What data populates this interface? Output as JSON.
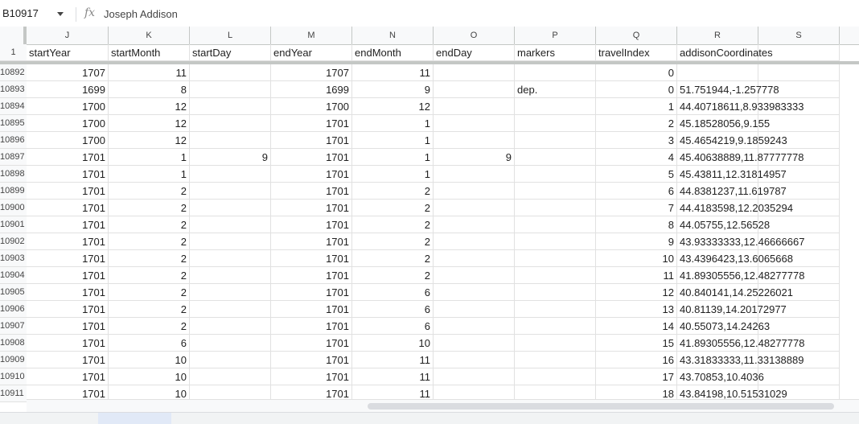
{
  "formula_bar": {
    "name_box": "B10917",
    "fx_icon": "fx",
    "content": "Joseph Addison"
  },
  "columns": [
    "J",
    "K",
    "L",
    "M",
    "N",
    "O",
    "P",
    "Q",
    "R",
    "S"
  ],
  "header_row": {
    "row_number": "1",
    "cells": [
      "startYear",
      "startMonth",
      "startDay",
      "endYear",
      "endMonth",
      "endDay",
      "markers",
      "travelIndex",
      "addisonCoordinates",
      ""
    ]
  },
  "rows": [
    {
      "num": "10892",
      "cells": [
        "1707",
        "11",
        "",
        "1707",
        "11",
        "",
        "",
        "0",
        "",
        ""
      ]
    },
    {
      "num": "10893",
      "cells": [
        "1699",
        "8",
        "",
        "1699",
        "9",
        "",
        "dep.",
        "0",
        "51.751944,-1.257778",
        ""
      ]
    },
    {
      "num": "10894",
      "cells": [
        "1700",
        "12",
        "",
        "1700",
        "12",
        "",
        "",
        "1",
        "44.40718611,8.933983333",
        ""
      ]
    },
    {
      "num": "10895",
      "cells": [
        "1700",
        "12",
        "",
        "1701",
        "1",
        "",
        "",
        "2",
        "45.18528056,9.155",
        ""
      ]
    },
    {
      "num": "10896",
      "cells": [
        "1700",
        "12",
        "",
        "1701",
        "1",
        "",
        "",
        "3",
        "45.4654219,9.1859243",
        ""
      ]
    },
    {
      "num": "10897",
      "cells": [
        "1701",
        "1",
        "9",
        "1701",
        "1",
        "9",
        "",
        "4",
        "45.40638889,11.87777778",
        ""
      ]
    },
    {
      "num": "10898",
      "cells": [
        "1701",
        "1",
        "",
        "1701",
        "1",
        "",
        "",
        "5",
        "45.43811,12.31814957",
        ""
      ]
    },
    {
      "num": "10899",
      "cells": [
        "1701",
        "2",
        "",
        "1701",
        "2",
        "",
        "",
        "6",
        "44.8381237,11.619787",
        ""
      ]
    },
    {
      "num": "10900",
      "cells": [
        "1701",
        "2",
        "",
        "1701",
        "2",
        "",
        "",
        "7",
        "44.4183598,12.2035294",
        ""
      ]
    },
    {
      "num": "10901",
      "cells": [
        "1701",
        "2",
        "",
        "1701",
        "2",
        "",
        "",
        "8",
        "44.05755,12.56528",
        ""
      ]
    },
    {
      "num": "10902",
      "cells": [
        "1701",
        "2",
        "",
        "1701",
        "2",
        "",
        "",
        "9",
        "43.93333333,12.46666667",
        ""
      ]
    },
    {
      "num": "10903",
      "cells": [
        "1701",
        "2",
        "",
        "1701",
        "2",
        "",
        "",
        "10",
        "43.4396423,13.6065668",
        ""
      ]
    },
    {
      "num": "10904",
      "cells": [
        "1701",
        "2",
        "",
        "1701",
        "2",
        "",
        "",
        "11",
        "41.89305556,12.48277778",
        ""
      ]
    },
    {
      "num": "10905",
      "cells": [
        "1701",
        "2",
        "",
        "1701",
        "6",
        "",
        "",
        "12",
        "40.840141,14.25226021",
        ""
      ]
    },
    {
      "num": "10906",
      "cells": [
        "1701",
        "2",
        "",
        "1701",
        "6",
        "",
        "",
        "13",
        "40.81139,14.20172977",
        ""
      ]
    },
    {
      "num": "10907",
      "cells": [
        "1701",
        "2",
        "",
        "1701",
        "6",
        "",
        "",
        "14",
        "40.55073,14.24263",
        ""
      ]
    },
    {
      "num": "10908",
      "cells": [
        "1701",
        "6",
        "",
        "1701",
        "10",
        "",
        "",
        "15",
        "41.89305556,12.48277778",
        ""
      ]
    },
    {
      "num": "10909",
      "cells": [
        "1701",
        "10",
        "",
        "1701",
        "11",
        "",
        "",
        "16",
        "43.31833333,11.33138889",
        ""
      ]
    },
    {
      "num": "10910",
      "cells": [
        "1701",
        "10",
        "",
        "1701",
        "11",
        "",
        "",
        "17",
        "43.70853,10.4036",
        ""
      ]
    },
    {
      "num": "10911",
      "cells": [
        "1701",
        "10",
        "",
        "1701",
        "11",
        "",
        "",
        "18",
        "43.84198,10.51531029",
        ""
      ]
    }
  ],
  "colors": {
    "header_bg": "#f8f9fa",
    "gridline": "#e1e1e1",
    "freeze_bar": "#c4c7c5",
    "active_tab": "#e1e9f7"
  }
}
